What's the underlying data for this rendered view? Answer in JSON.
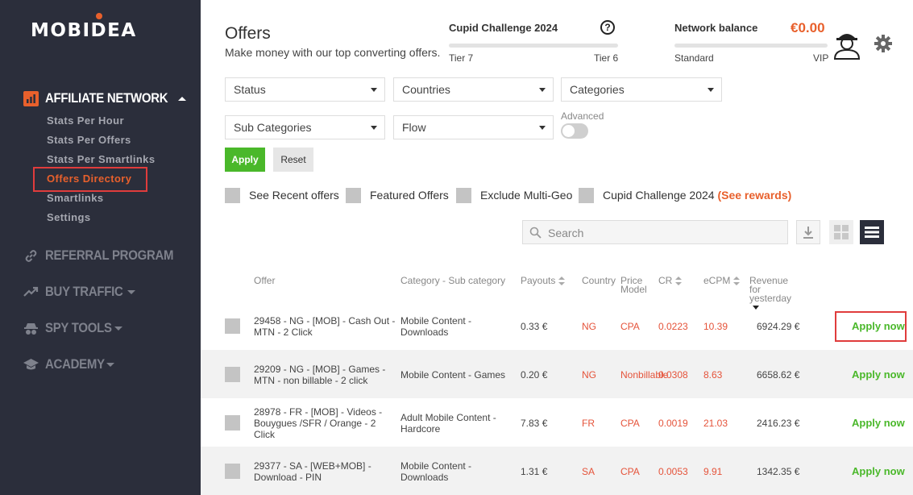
{
  "brand": {
    "name": "MOBIDEA",
    "accent": "#e8602c"
  },
  "sidebar": {
    "sections": [
      {
        "label": "AFFILIATE NETWORK",
        "icon": "bar-chart-icon",
        "expanded": true
      },
      {
        "label": "REFERRAL PROGRAM",
        "icon": "link-icon"
      },
      {
        "label": "BUY TRAFFIC",
        "icon": "trending-up-icon"
      },
      {
        "label": "SPY TOOLS",
        "icon": "spy-icon"
      },
      {
        "label": "ACADEMY",
        "icon": "graduation-cap-icon"
      }
    ],
    "affiliate_items": [
      {
        "label": "Stats Per Hour"
      },
      {
        "label": "Stats Per Offers"
      },
      {
        "label": "Stats Per Smartlinks"
      },
      {
        "label": "Offers Directory",
        "active": true
      },
      {
        "label": "Smartlinks"
      },
      {
        "label": "Settings"
      }
    ]
  },
  "header": {
    "title": "Offers",
    "subtitle": "Make money with our top converting offers.",
    "challenge": {
      "title": "Cupid Challenge 2024",
      "tier_left": "Tier 7",
      "tier_right": "Tier 6"
    },
    "balance": {
      "title": "Network balance",
      "value": "€0.00",
      "tier_left": "Standard",
      "tier_right": "VIP"
    }
  },
  "filters": {
    "status": "Status",
    "countries": "Countries",
    "categories": "Categories",
    "sub_categories": "Sub Categories",
    "flow": "Flow",
    "advanced_label": "Advanced",
    "apply_label": "Apply",
    "reset_label": "Reset",
    "checkboxes": {
      "recent": "See Recent offers",
      "featured": "Featured Offers",
      "multi_geo": "Exclude Multi-Geo",
      "challenge": "Cupid Challenge 2024",
      "challenge_link": "(See rewards)"
    }
  },
  "search": {
    "placeholder": "Search"
  },
  "table": {
    "headers": {
      "offer": "Offer",
      "category": "Category - Sub category",
      "payouts": "Payouts",
      "country": "Country",
      "price_model_1": "Price",
      "price_model_2": "Model",
      "cr": "CR",
      "ecpm": "eCPM",
      "revenue_1": "Revenue",
      "revenue_2": "for",
      "revenue_3": "yesterday"
    },
    "rows": [
      {
        "offer_1": "29458 - NG - [MOB] - Cash Out -",
        "offer_2": "MTN - 2 Click",
        "offer_3": "",
        "cat_1": "Mobile Content -",
        "cat_2": "Downloads",
        "payout": "0.33 €",
        "country": "NG",
        "model": "CPA",
        "cr": "0.0223",
        "ecpm": "10.39",
        "revenue": "6924.29 €",
        "action": "Apply now"
      },
      {
        "offer_1": "29209 - NG - [MOB] - Games -",
        "offer_2": "MTN - non billable - 2 click",
        "offer_3": "",
        "cat_1": "Mobile Content - Games",
        "cat_2": "",
        "payout": "0.20 €",
        "country": "NG",
        "model": "Nonbillable",
        "cr": "0.0308",
        "ecpm": "8.63",
        "revenue": "6658.62 €",
        "action": "Apply now"
      },
      {
        "offer_1": "28978 - FR - [MOB] - Videos -",
        "offer_2": "Bouygues /SFR / Orange - 2",
        "offer_3": "Click",
        "cat_1": "Adult Mobile Content -",
        "cat_2": "Hardcore",
        "payout": "7.83 €",
        "country": "FR",
        "model": "CPA",
        "cr": "0.0019",
        "ecpm": "21.03",
        "revenue": "2416.23 €",
        "action": "Apply now"
      },
      {
        "offer_1": "29377 - SA - [WEB+MOB] -",
        "offer_2": "Download - PIN",
        "offer_3": "",
        "cat_1": "Mobile Content -",
        "cat_2": "Downloads",
        "payout": "1.31 €",
        "country": "SA",
        "model": "CPA",
        "cr": "0.0053",
        "ecpm": "9.91",
        "revenue": "1342.35 €",
        "action": "Apply now"
      }
    ]
  }
}
